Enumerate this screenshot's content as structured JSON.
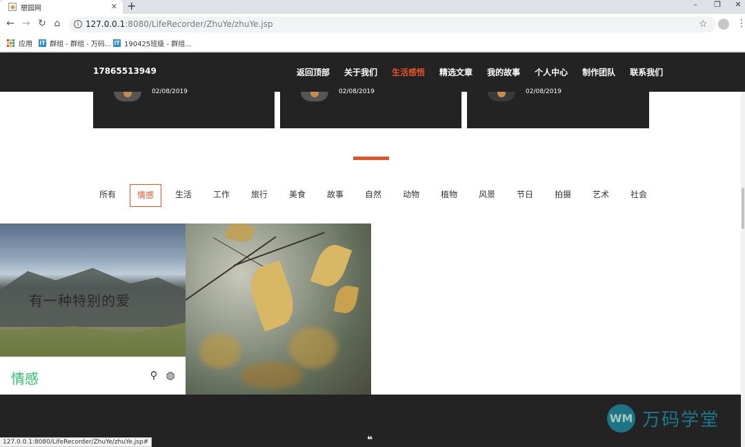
{
  "browser": {
    "tab_title": "憩园网",
    "tab_close": "✕",
    "new_tab": "+",
    "url_host": "127.0.0.1",
    "url_rest": ":8080/LifeRecorder/ZhuYe/zhuYe.jsp",
    "bookmarks": [
      {
        "label": "应用"
      },
      {
        "label": "群组 - 群组 - 万码..."
      },
      {
        "label": "190425班级 - 群组..."
      }
    ],
    "status_url": "127.0.0.1:8080/LifeRecorder/ZhuYe/zhuYe.jsp#"
  },
  "site": {
    "phone": "17865513949",
    "nav": [
      "返回顶部",
      "关于我们",
      "生活感悟",
      "精选文章",
      "我的故事",
      "个人中心",
      "制作团队",
      "联系我们"
    ],
    "nav_active_index": 2,
    "accent_color": "#e5522a",
    "cards": [
      {
        "date": "02/08/2019"
      },
      {
        "date": "02/08/2019"
      },
      {
        "date": "02/08/2019"
      }
    ],
    "filters": [
      "所有",
      "情感",
      "生活",
      "工作",
      "旅行",
      "美食",
      "故事",
      "自然",
      "动物",
      "植物",
      "风景",
      "节日",
      "拍摄",
      "艺术",
      "社会"
    ],
    "filter_active_index": 1,
    "tiles": [
      {
        "overlay_text": "有一种特别的爱",
        "caption": "情感",
        "caption_color": "#2fc56a",
        "icons": [
          "search-icon",
          "globe-icon"
        ]
      },
      {
        "image": "autumn-leaves"
      }
    ],
    "footer": {
      "quote_mark": "❝",
      "logo_mark": "WM",
      "logo_text": "万码学堂"
    }
  }
}
